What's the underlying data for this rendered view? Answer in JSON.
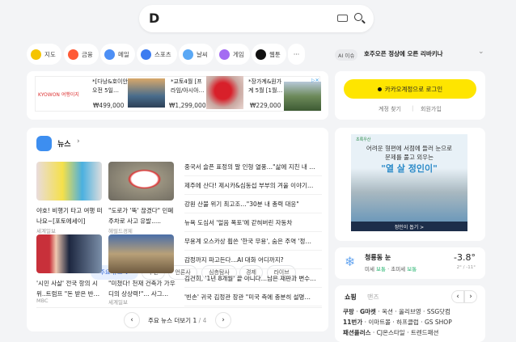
{
  "search": {
    "logo": "D",
    "keyboard_icon": "keyboard-icon",
    "search_icon": "search-icon"
  },
  "shortcuts": [
    {
      "label": "지도",
      "color": "#f5c400"
    },
    {
      "label": "금융",
      "color": "#ff5a36"
    },
    {
      "label": "메일",
      "color": "#4d8ff5"
    },
    {
      "label": "스포츠",
      "color": "#3d7cf0"
    },
    {
      "label": "날씨",
      "color": "#5aa8f5"
    },
    {
      "label": "게임",
      "color": "#a46cf2"
    },
    {
      "label": "웹툰",
      "color": "#111111"
    }
  ],
  "more_label": "···",
  "ad_top": {
    "brand": "KYOWON 여행이지",
    "items": [
      {
        "title": "*[다낭&호이안 오전 5일…",
        "price": "₩499,000"
      },
      {
        "title": "*교토4월 [프라임/아시아…",
        "price": "₩1,299,000"
      },
      {
        "title": "*장가계&원가계 5월 [1월…",
        "price": "₩229,000"
      }
    ]
  },
  "news": {
    "title": "뉴스",
    "tabs": [
      "주요 뉴스",
      "추천",
      "언론사",
      "심층탐사",
      "경제",
      "라이브"
    ],
    "cards": [
      {
        "caption": "야호! 비행기 타고 여행 떠나요~[포토에세이]",
        "source": "세계일보"
      },
      {
        "caption": "\"도로가 '뚝' 끊겼다\" 민폐 주차로 사고 유발.....",
        "source": "헤럴드경제"
      },
      {
        "caption": "'시민 사살' 전국 항의 시위..트럼프 \"돈 받은 반…",
        "source": "MBC"
      },
      {
        "caption": "\"미쳤다! 천재 건축가 가우디의 상상력!\"... 사그…",
        "source": "세계일보"
      }
    ],
    "headlines": [
      "중국서 슬픈 표정의 말 인형 열풍…\"삶에 지친 내 …",
      "제주에 산다! 제시카&심동섭 부부의 겨울 이야기…",
      "강원 산불 위기 최고조…\"30분 내 총력 대응\"",
      "뉴욕 도심서 '얼음 폭포'에 갇혀버린 자동차",
      "무용계 오스카상 휩쓴 '한국 무용', 숨은 주역 '정…",
      "감정까지 파고든다…AI 대화 어디까지?",
      "김건희, '1년 8개월' 끝 아니다…남은 재판과 변수…",
      "'빈손' 귀국 김정관 장관 \"미국 측에 충분히 설명…"
    ],
    "more_label": "주요 뉴스 더보기",
    "page": "1",
    "total": "4"
  },
  "ai_issue": {
    "badge": "AI 이슈",
    "text": "호주오픈 정상에 오른 리바키나"
  },
  "login": {
    "button": "카카오계정으로 로그인",
    "find": "계정 찾기",
    "signup": "회원가입",
    "color": "#fee500"
  },
  "ad_right": {
    "brand": "초록우산",
    "line1": "어려운 형편에 서점에 들러 눈으로",
    "line2": "문제를 풀고 외우는",
    "slogan": "\"열 살 정인이\"",
    "cta": "정인이 돕기 >"
  },
  "weather": {
    "location": "청룡동 눈",
    "dust_label": "미세",
    "dust": "보통",
    "fine_label": "초미세",
    "fine": "보통",
    "temp": "-3.8°",
    "range": "2° / -11°"
  },
  "shopping": {
    "tabs": [
      "쇼핑",
      "맨즈"
    ],
    "rows": [
      [
        "쿠팡",
        "G마켓",
        "옥션",
        "올리브영",
        "SSG닷컴"
      ],
      [
        "11번가",
        "이마트몰",
        "하프클럽",
        "GS SHOP"
      ],
      [
        "패션플러스",
        "CJ온스타일",
        "트렌드패션"
      ]
    ]
  }
}
